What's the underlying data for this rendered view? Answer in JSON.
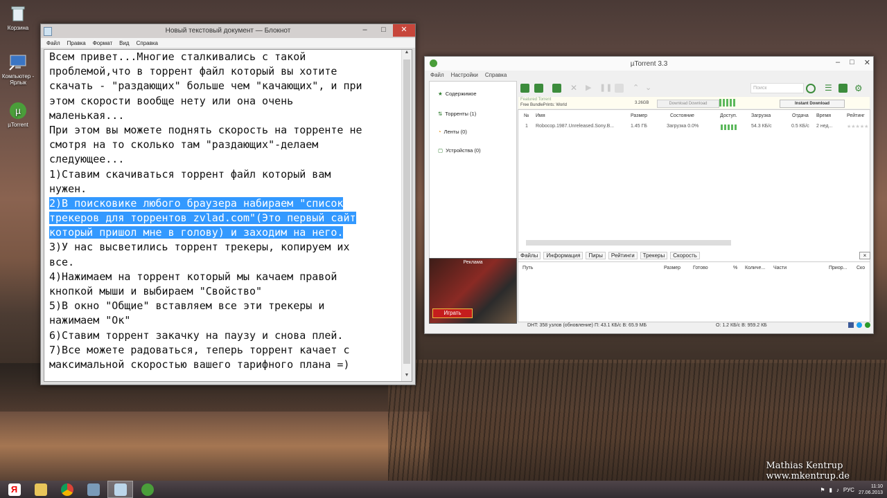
{
  "desktop": {
    "icons": [
      {
        "label": "Корзина"
      },
      {
        "label": "Компьютер - Ярлык"
      },
      {
        "label": "µTorrent"
      }
    ],
    "watermark": {
      "line1": "Mathias Kentrup",
      "line2": "www.mkentrup.de"
    }
  },
  "notepad": {
    "title": "Новый текстовый документ — Блокнот",
    "menu": [
      "Файл",
      "Правка",
      "Формат",
      "Вид",
      "Справка"
    ],
    "lines": [
      {
        "text": "Всем привет...Многие сталкивались с такой",
        "selected": false
      },
      {
        "text": "проблемой,что в торрент файл который вы хотите",
        "selected": false
      },
      {
        "text": "скачать - \"раздающих\" больше чем \"качающих\", и при",
        "selected": false
      },
      {
        "text": "этом скорости вообще нету или она очень",
        "selected": false
      },
      {
        "text": "маленькая...",
        "selected": false
      },
      {
        "text": "При этом вы можете поднять скорость на торренте не",
        "selected": false
      },
      {
        "text": "смотря на то сколько там \"раздающих\"-делаем",
        "selected": false
      },
      {
        "text": "следующее...",
        "selected": false
      },
      {
        "text": "1)Ставим скачиваться торрент файл который вам",
        "selected": false
      },
      {
        "text": "нужен.",
        "selected": false
      },
      {
        "text": "2)В поисковике любого браузера набираем \"список",
        "selected": true
      },
      {
        "text": "трекеров для торрентов zvlad.com\"(Это первый сайт",
        "selected": true
      },
      {
        "text": "который пришол мне в голову) и заходим на него.",
        "selected": true
      },
      {
        "text": "3)У нас высветились торрент трекеры, копируем их",
        "selected": false
      },
      {
        "text": "все.",
        "selected": false
      },
      {
        "text": "4)Нажимаем на торрент который мы качаем правой",
        "selected": false
      },
      {
        "text": "кнопкой мыши и выбираем \"Свойство\"",
        "selected": false
      },
      {
        "text": "5)В окно \"Общие\" вставляем все эти трекеры и",
        "selected": false
      },
      {
        "text": "нажимаем \"Ок\"",
        "selected": false
      },
      {
        "text": "6)Ставим торрент закачку на паузу и снова плей.",
        "selected": false
      },
      {
        "text": "7)Все можете радоваться, теперь торрент качает с",
        "selected": false
      },
      {
        "text": "максимальной скоростью вашего тарифного плана =)",
        "selected": false
      }
    ]
  },
  "utorrent": {
    "title": "µTorrent 3.3",
    "menu": [
      "Файл",
      "Настройки",
      "Справка"
    ],
    "sidebar": [
      {
        "label": "Содержимое"
      },
      {
        "label": "Торренты (1)"
      },
      {
        "label": "Ленты (0)"
      },
      {
        "label": "Устройства (0)"
      }
    ],
    "search_placeholder": "Поиск",
    "ad_strip": {
      "line1": "Featured Torrent",
      "line2": "Free BundlePrints: World",
      "size": "3.26GB",
      "download_label": "Download Download",
      "instant_label": "Instant Download"
    },
    "ad_box": {
      "label": "Реклама",
      "button": "Играть"
    },
    "columns": [
      "№",
      "Имя",
      "Размер",
      "Состояние",
      "Доступ.",
      "Загрузка",
      "Отдача",
      "Время",
      "Рейтинг"
    ],
    "row": {
      "num": "1",
      "name": "Robocop.1987.Unreleased.Sony.B...",
      "size": "1.45 ГБ",
      "status": "Загрузка 0.0%",
      "down": "54.3 КБ/с",
      "up": "0.5 КБ/с",
      "eta": "2 нед...",
      "rating": "★★★★★"
    },
    "tabs": [
      "Файлы",
      "Информация",
      "Пиры",
      "Рейтинги",
      "Трекеры",
      "Скорость"
    ],
    "detail_columns": [
      "Путь",
      "Размер",
      "Готово",
      "%",
      "Количе...",
      "Части",
      "Приор...",
      "Ско"
    ],
    "status": {
      "dht": "DHT: 358 узлов  (обновление)  П: 43.1 КБ/с В: 65.9 МБ",
      "up": "О: 1.2 КБ/с В: 959.2 КБ"
    }
  },
  "taskbar": {
    "lang": "РУС",
    "time": "11:10",
    "date": "27.06.2013"
  },
  "colors": {
    "selection": "#3399ff",
    "utorrent_green": "#4a9e3a"
  }
}
